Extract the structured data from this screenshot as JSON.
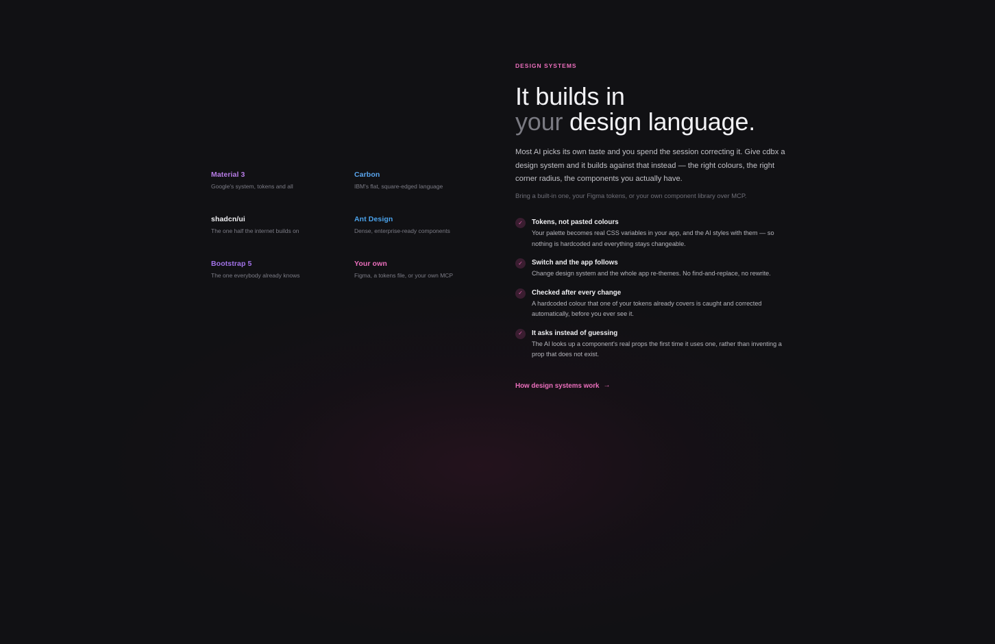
{
  "colors": {
    "accent": "#ec6fbd",
    "material": "#b77ce6",
    "carbon": "#5aa6ef",
    "shadcn": "#f1f1f4",
    "ant": "#4ba3ec",
    "bootstrap": "#a272e8",
    "own": "#ec6fbd"
  },
  "systems": [
    {
      "name": "Material 3",
      "desc": "Google's system, tokens and all"
    },
    {
      "name": "Carbon",
      "desc": "IBM's flat, square-edged language"
    },
    {
      "name": "shadcn/ui",
      "desc": "The one half the internet builds on"
    },
    {
      "name": "Ant Design",
      "desc": "Dense, enterprise-ready components"
    },
    {
      "name": "Bootstrap 5",
      "desc": "The one everybody already knows"
    },
    {
      "name": "Your own",
      "desc": "Figma, a tokens file, or your own MCP"
    }
  ],
  "section": {
    "eyebrow": "DESIGN SYSTEMS",
    "headline_line1": "It builds in",
    "headline_muted": "your",
    "headline_rest": " design language.",
    "lead": "Most AI picks its own taste and you spend the session correcting it. Give cdbx a design system and it builds against that instead — the right colours, the right corner radius, the components you actually have.",
    "sub": "Bring a built-in one, your Figma tokens, or your own component library over MCP."
  },
  "features": [
    {
      "title": "Tokens, not pasted colours",
      "body": "Your palette becomes real CSS variables in your app, and the AI styles with them — so nothing is hardcoded and everything stays changeable.",
      "icon": "check-icon"
    },
    {
      "title": "Switch and the app follows",
      "body": "Change design system and the whole app re-themes. No find-and-replace, no rewrite.",
      "icon": "check-icon"
    },
    {
      "title": "Checked after every change",
      "body": "A hardcoded colour that one of your tokens already covers is caught and corrected automatically, before you ever see it.",
      "icon": "check-icon"
    },
    {
      "title": "It asks instead of guessing",
      "body": "The AI looks up a component's real props the first time it uses one, rather than inventing a prop that does not exist.",
      "icon": "check-icon"
    }
  ],
  "cta": {
    "label": "How design systems work",
    "icon": "arrow-right-icon"
  }
}
